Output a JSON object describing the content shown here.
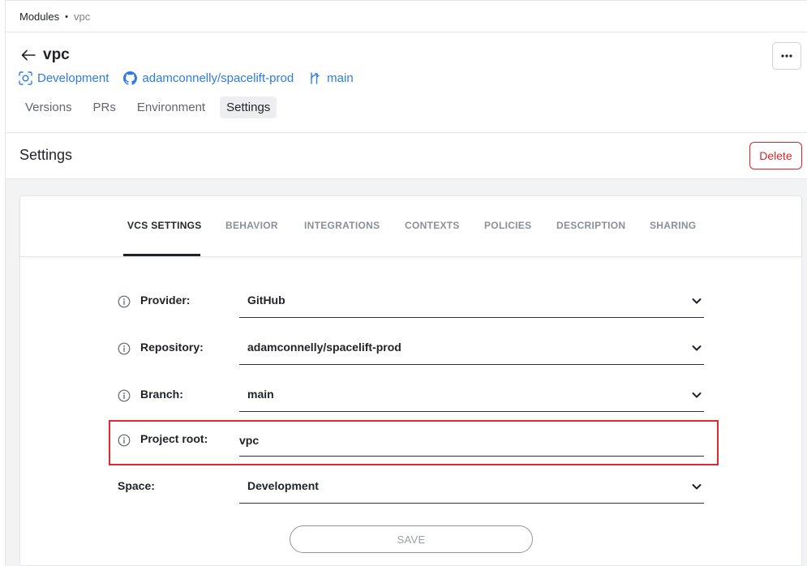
{
  "breadcrumb": {
    "root": "Modules",
    "separator": "•",
    "current": "vpc"
  },
  "header": {
    "title": "vpc",
    "more_label": "•••"
  },
  "meta": {
    "space": "Development",
    "repository": "adamconnelly/spacelift-prod",
    "branch": "main"
  },
  "tabs": [
    {
      "label": "Versions"
    },
    {
      "label": "PRs"
    },
    {
      "label": "Environment"
    },
    {
      "label": "Settings",
      "active": true
    }
  ],
  "settings": {
    "title": "Settings",
    "delete_label": "Delete"
  },
  "settings_tabs": [
    {
      "label": "VCS SETTINGS",
      "active": true
    },
    {
      "label": "BEHAVIOR"
    },
    {
      "label": "INTEGRATIONS"
    },
    {
      "label": "CONTEXTS"
    },
    {
      "label": "POLICIES"
    },
    {
      "label": "DESCRIPTION"
    },
    {
      "label": "SHARING"
    }
  ],
  "form": {
    "provider": {
      "label": "Provider:",
      "value": "GitHub"
    },
    "repository": {
      "label": "Repository:",
      "value": "adamconnelly/spacelift-prod"
    },
    "branch": {
      "label": "Branch:",
      "value": "main"
    },
    "project_root": {
      "label": "Project root:",
      "value": "vpc"
    },
    "space": {
      "label": "Space:",
      "value": "Development"
    },
    "save_label": "SAVE"
  },
  "colors": {
    "link": "#2d7be5",
    "danger": "#d3272f",
    "highlight": "#e0282f",
    "text": "#1f2328",
    "muted": "#8a9097"
  }
}
